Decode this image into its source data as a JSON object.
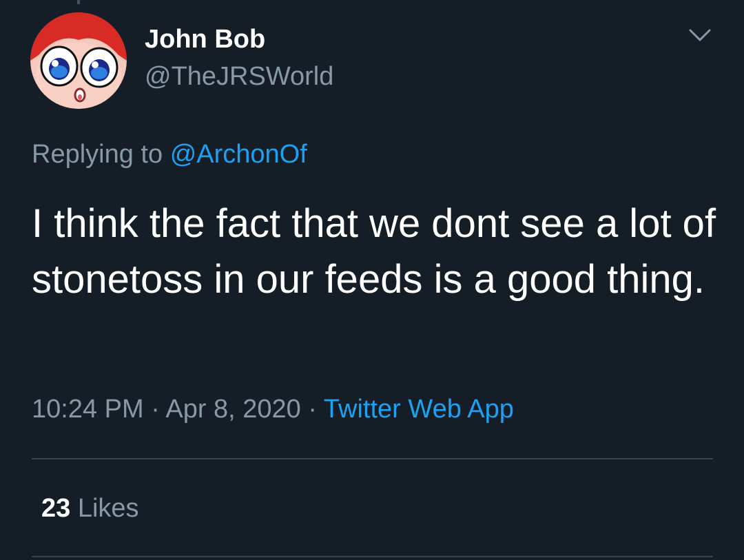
{
  "tweet": {
    "author": {
      "display_name": "John Bob",
      "handle": "@TheJRSWorld",
      "avatar_icon": "cartoon-avatar-icon"
    },
    "menu_icon": "chevron-down-icon",
    "reply": {
      "prefix": "Replying to",
      "mention": "@ArchonOf"
    },
    "text": "I think the fact that we dont see a lot of stonetoss in our feeds is a good thing.",
    "meta": {
      "time": "10:24 PM",
      "date": "Apr 8, 2020",
      "separator": "·",
      "source": "Twitter Web App"
    },
    "stats": {
      "likes_count": "23",
      "likes_label": "Likes"
    }
  },
  "colors": {
    "background": "#151d26",
    "primary_text": "#ffffff",
    "secondary_text": "#8899a6",
    "accent": "#1da1f2",
    "divider": "#38444d"
  }
}
